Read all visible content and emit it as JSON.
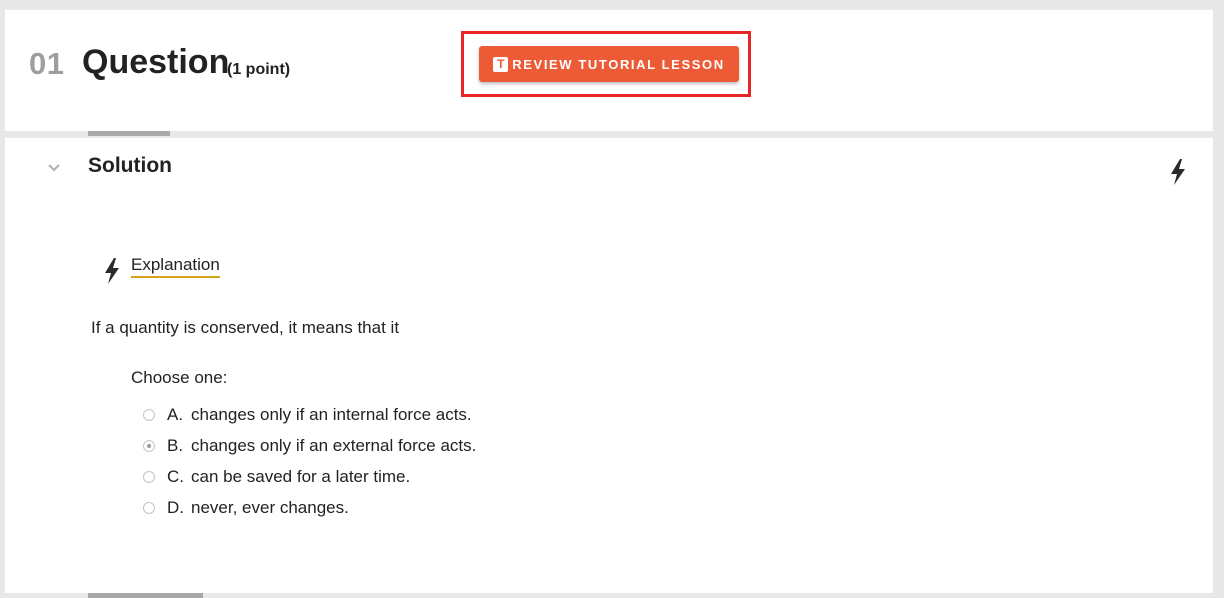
{
  "question": {
    "number": "01",
    "title": "Question",
    "points": "(1 point)",
    "review_button": {
      "icon_letter": "T",
      "label": "REVIEW TUTORIAL LESSON"
    }
  },
  "solution": {
    "title": "Solution",
    "explanation_label": "Explanation",
    "question_text": "If a quantity is conserved, it means that it",
    "choose_label": "Choose one:",
    "options": [
      {
        "letter": "A.",
        "text": "changes only if an internal force acts.",
        "selected": false
      },
      {
        "letter": "B.",
        "text": "changes only if an external force acts.",
        "selected": true
      },
      {
        "letter": "C.",
        "text": "can be saved for a later time.",
        "selected": false
      },
      {
        "letter": "D.",
        "text": "never, ever changes.",
        "selected": false
      }
    ]
  },
  "icons": {
    "collapse": "chevron-down-icon",
    "hint": "lightning-bolt-icon"
  },
  "colors": {
    "accent_button": "#ec5b36",
    "highlight_border": "#e8262a",
    "link_underline": "#d8a31c"
  }
}
